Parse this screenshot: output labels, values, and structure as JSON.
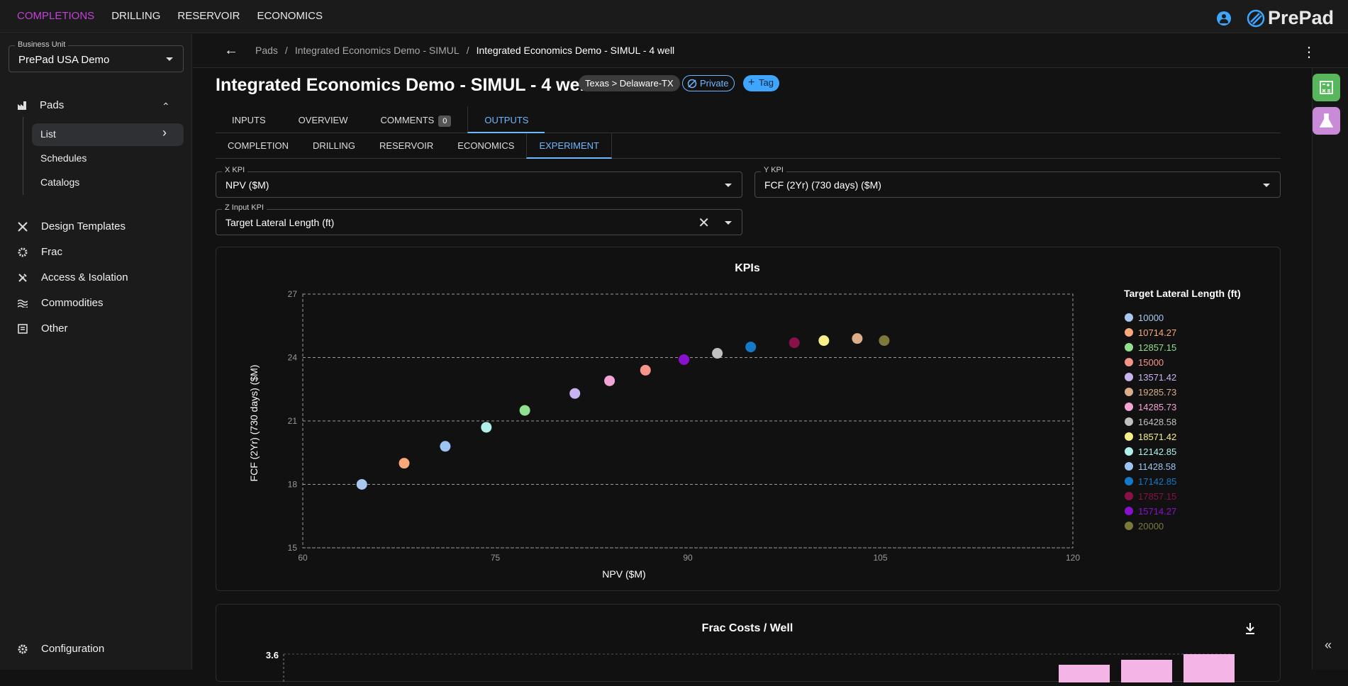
{
  "topnav": {
    "items": [
      "COMPLETIONS",
      "DRILLING",
      "RESERVOIR",
      "ECONOMICS"
    ],
    "active": "COMPLETIONS",
    "logo_text": "PrePad"
  },
  "sidebar": {
    "business_unit_label": "Business Unit",
    "business_unit_value": "PrePad USA Demo",
    "pads_label": "Pads",
    "sub_items": [
      "List",
      "Schedules",
      "Catalogs"
    ],
    "items": [
      "Design Templates",
      "Frac",
      "Access & Isolation",
      "Commodities",
      "Other"
    ],
    "configuration": "Configuration"
  },
  "breadcrumb": {
    "items": [
      "Pads",
      "Integrated Economics Demo - SIMUL",
      "Integrated Economics Demo - SIMUL - 4 well"
    ],
    "separator": "/"
  },
  "page": {
    "title": "Integrated Economics Demo - SIMUL - 4 well",
    "location_chip": "Texas > Delaware-TX",
    "privacy_chip": "Private",
    "tag_chip": "Tag"
  },
  "tabs": [
    {
      "label": "INPUTS"
    },
    {
      "label": "OVERVIEW"
    },
    {
      "label": "COMMENTS",
      "badge": "0"
    },
    {
      "label": "OUTPUTS"
    }
  ],
  "subtabs": [
    "COMPLETION",
    "DRILLING",
    "RESERVOIR",
    "ECONOMICS",
    "EXPERIMENT"
  ],
  "fields": {
    "x_kpi_label": "X KPI",
    "x_kpi_value": "NPV ($M)",
    "y_kpi_label": "Y KPI",
    "y_kpi_value": "FCF (2Yr) (730 days) ($M)",
    "z_kpi_label": "Z Input KPI",
    "z_kpi_value": "Target Lateral Length (ft)"
  },
  "chart_data": [
    {
      "type": "scatter",
      "title": "KPIs",
      "xlabel": "NPV ($M)",
      "ylabel": "FCF (2Yr) (730 days) ($M)",
      "xlim": [
        60,
        120
      ],
      "ylim": [
        15,
        27
      ],
      "xticks": [
        "60",
        "75",
        "90",
        "105",
        "120"
      ],
      "yticks": [
        "15",
        "18",
        "21",
        "24",
        "27"
      ],
      "grid": "dashed",
      "legend_title": "Target Lateral Length (ft)",
      "legend_position": "right",
      "series": [
        {
          "name": "10000",
          "color": "#a8c8f0",
          "x": 64.6,
          "y": 18.0
        },
        {
          "name": "10714.27",
          "color": "#f9a97a",
          "x": 67.9,
          "y": 19.0
        },
        {
          "name": "12857.15",
          "color": "#90e08f",
          "x": 77.3,
          "y": 21.5
        },
        {
          "name": "15000",
          "color": "#f7948a",
          "x": 86.7,
          "y": 23.4
        },
        {
          "name": "13571.42",
          "color": "#c8b4f0",
          "x": 81.2,
          "y": 22.3
        },
        {
          "name": "19285.73",
          "color": "#d9ae88",
          "x": 103.2,
          "y": 24.9
        },
        {
          "name": "14285.73",
          "color": "#f4a3d6",
          "x": 83.9,
          "y": 22.9
        },
        {
          "name": "16428.58",
          "color": "#c0c0c0",
          "x": 92.3,
          "y": 24.2
        },
        {
          "name": "18571.42",
          "color": "#f8f08a",
          "x": 100.6,
          "y": 24.8
        },
        {
          "name": "12142.85",
          "color": "#b2f0ec",
          "x": 74.3,
          "y": 20.7
        },
        {
          "name": "11428.58",
          "color": "#9cc5f4",
          "x": 71.1,
          "y": 19.8
        },
        {
          "name": "17142.85",
          "color": "#1479c9",
          "x": 94.9,
          "y": 24.5
        },
        {
          "name": "17857.15",
          "color": "#8a1148",
          "x": 98.3,
          "y": 24.7
        },
        {
          "name": "15714.27",
          "color": "#8a10d0",
          "x": 89.7,
          "y": 23.9
        },
        {
          "name": "20000",
          "color": "#7a7a3a",
          "x": 105.3,
          "y": 24.8
        }
      ]
    },
    {
      "type": "bar",
      "title": "Frac Costs / Well",
      "yticks": [
        "3.6"
      ]
    }
  ]
}
